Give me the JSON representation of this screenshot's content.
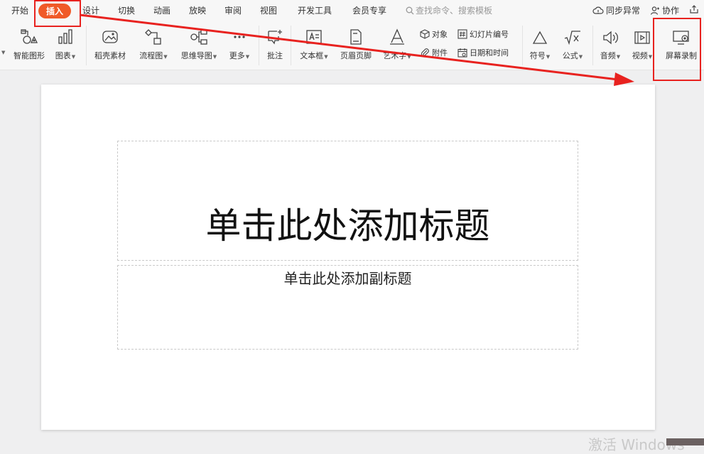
{
  "menu": {
    "tabs": [
      {
        "label": "开始"
      },
      {
        "label": "插入",
        "active": true
      },
      {
        "label": "设计"
      },
      {
        "label": "切换"
      },
      {
        "label": "动画"
      },
      {
        "label": "放映"
      },
      {
        "label": "审阅"
      },
      {
        "label": "视图"
      },
      {
        "label": "开发工具"
      },
      {
        "label": "会员专享"
      }
    ],
    "search_label": "查找命令、搜索模板",
    "sync_label": "同步异常",
    "collab_label": "协作"
  },
  "ribbon": {
    "smartart_label": "智能图形",
    "chart_label": "图表",
    "daoke_label": "稻壳素材",
    "flowchart_label": "流程图",
    "mindmap_label": "思维导图",
    "more_label": "更多",
    "comment_label": "批注",
    "textbox_label": "文本框",
    "headerfooter_label": "页眉页脚",
    "wordart_label": "艺术字",
    "object_label": "对象",
    "attachment_label": "附件",
    "slidenum_label": "幻灯片编号",
    "datetime_label": "日期和时间",
    "symbol_label": "符号",
    "formula_label": "公式",
    "audio_label": "音频",
    "video_label": "视频",
    "screenrec_label": "屏幕录制"
  },
  "slide": {
    "title_placeholder": "单击此处添加标题",
    "subtitle_placeholder": "单击此处添加副标题"
  },
  "watermark": "激活 Windows",
  "colors": {
    "accent": "#f05a28",
    "annotation_red": "#e8221f"
  }
}
